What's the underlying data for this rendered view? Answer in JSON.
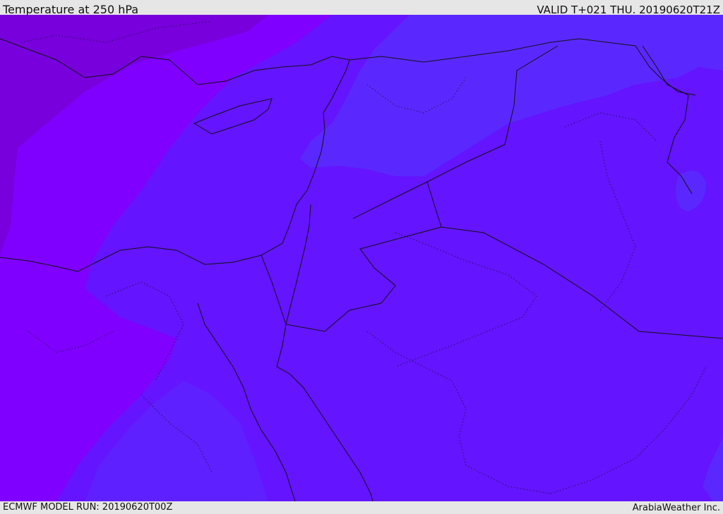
{
  "header": {
    "title": "Temperature at 250 hPa",
    "valid": "VALID T+021 THU. 20190620T21Z"
  },
  "footer": {
    "model_run": "ECMWF MODEL RUN: 20190620T00Z",
    "credit": "ArabiaWeather Inc."
  },
  "map": {
    "colors": {
      "coldest_band": "#7700dd",
      "cold_band": "#7f00ff",
      "mid_band": "#6414ff",
      "warm_band": "#5a28ff",
      "border": "#111111"
    }
  }
}
